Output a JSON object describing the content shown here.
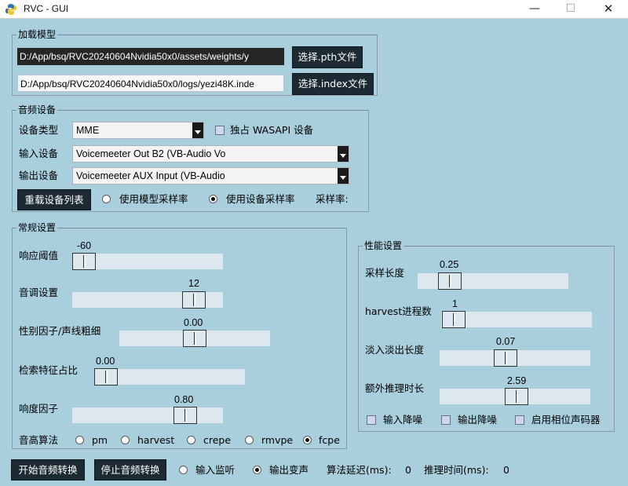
{
  "window": {
    "title": "RVC - GUI",
    "min_icon": "minimize-icon",
    "max_icon": "maximize-icon",
    "close_icon": "close-icon"
  },
  "load_model": {
    "title": "加载模型",
    "pth_path": "D:/App/bsq/RVC20240604Nvidia50x0/assets/weights/y",
    "pth_button": "选择.pth文件",
    "index_path": "D:/App/bsq/RVC20240604Nvidia50x0/logs/yezi48K.inde",
    "index_button": "选择.index文件"
  },
  "audio_device": {
    "title": "音频设备",
    "device_type_label": "设备类型",
    "device_type_value": "MME",
    "wasapi_label": "独占 WASAPI 设备",
    "input_label": "输入设备",
    "input_value": "Voicemeeter Out B2 (VB-Audio Vo",
    "output_label": "输出设备",
    "output_value": "Voicemeeter AUX Input (VB-Audio",
    "reload_button": "重载设备列表",
    "use_model_sr": "使用模型采样率",
    "use_device_sr": "使用设备采样率",
    "sr_label": "采样率:"
  },
  "general": {
    "title": "常规设置",
    "threshold_label": "响应阈值",
    "threshold_value": "-60",
    "pitch_label": "音调设置",
    "pitch_value": "12",
    "formant_label": "性别因子/声线粗细",
    "formant_value": "0.00",
    "index_rate_label": "检索特征占比",
    "index_rate_value": "0.00",
    "rms_label": "响度因子",
    "rms_value": "0.80",
    "f0_label": "音高算法",
    "f0_options": [
      "pm",
      "harvest",
      "crepe",
      "rmvpe",
      "fcpe"
    ]
  },
  "performance": {
    "title": "性能设置",
    "block_label": "采样长度",
    "block_value": "0.25",
    "harvest_label": "harvest进程数",
    "harvest_value": "1",
    "crossfade_label": "淡入淡出长度",
    "crossfade_value": "0.07",
    "extra_label": "额外推理时长",
    "extra_value": "2.59",
    "input_noise": "输入降噪",
    "output_noise": "输出降噪",
    "phase_vocoder": "启用相位声码器"
  },
  "bottom": {
    "start_button": "开始音频转换",
    "stop_button": "停止音频转换",
    "input_monitor": "输入监听",
    "output_voice": "输出变声",
    "delay_label": "算法延迟(ms):",
    "delay_value": "0",
    "infer_label": "推理时间(ms):",
    "infer_value": "0"
  }
}
